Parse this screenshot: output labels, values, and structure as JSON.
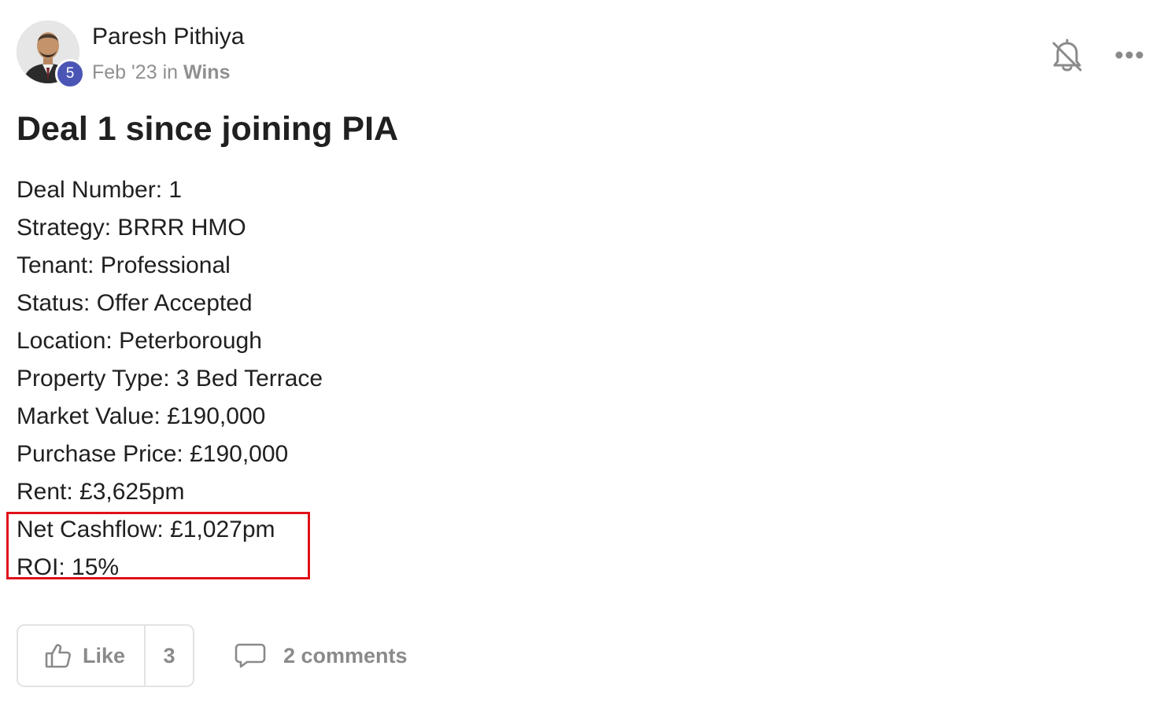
{
  "post": {
    "author": {
      "name": "Paresh Pithiya",
      "level": "5"
    },
    "meta": {
      "date": "Feb '23",
      "in_word": "in",
      "category": "Wins"
    },
    "title": "Deal 1 since joining PIA",
    "lines": [
      "Deal Number: 1",
      "Strategy: BRRR HMO",
      "Tenant: Professional",
      "Status: Offer Accepted",
      "Location: Peterborough",
      "Property Type: 3 Bed Terrace",
      "Market Value: £190,000",
      "Purchase Price: £190,000",
      "Rent: £3,625pm",
      "Net Cashflow: £1,027pm",
      "ROI: 15%"
    ],
    "actions": {
      "like_label": "Like",
      "like_count": "3",
      "comments_label": "2 comments"
    },
    "icons": {
      "notifications": "bell-off-icon",
      "more": "more-horizontal-icon",
      "like": "thumbs-up-icon",
      "comments": "comment-bubble-icon"
    }
  },
  "colors": {
    "level_badge": "#4a55b5",
    "highlight_box": "#e0111a",
    "muted_text": "#909090"
  }
}
